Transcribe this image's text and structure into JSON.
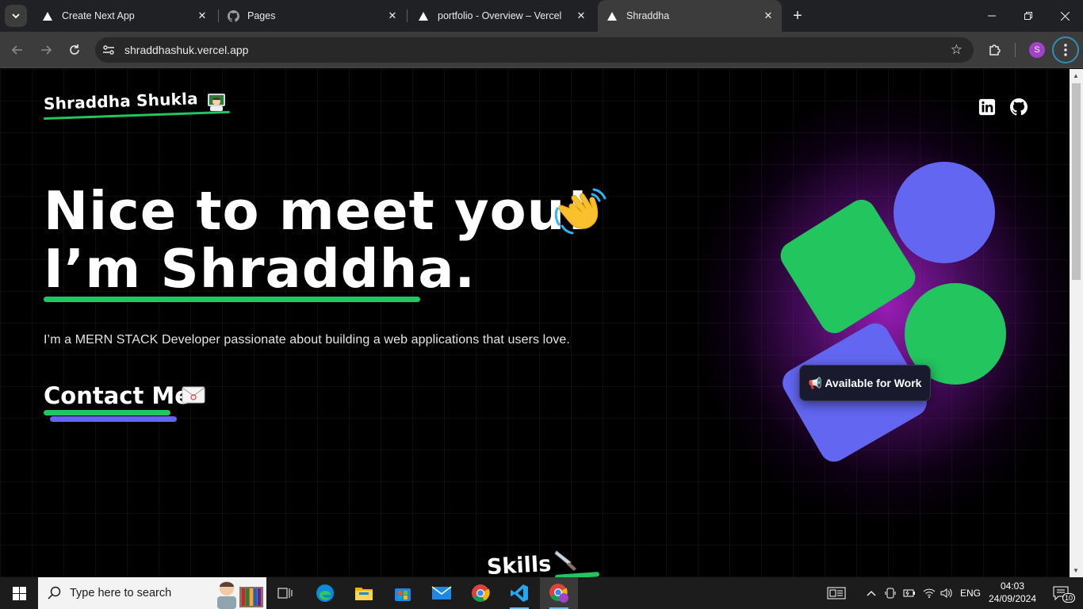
{
  "browser": {
    "tabs": [
      {
        "title": "Create Next App",
        "icon": "vercel-triangle-icon"
      },
      {
        "title": "Pages",
        "icon": "github-icon"
      },
      {
        "title": "portfolio - Overview – Vercel",
        "icon": "vercel-triangle-icon"
      },
      {
        "title": "Shraddha",
        "icon": "vercel-triangle-icon",
        "active": true
      }
    ],
    "url": "shraddhashuk.vercel.app",
    "profile_initial": "S"
  },
  "page": {
    "brand_name": "Shraddha Shukla",
    "hero_line1": "Nice to meet you!",
    "hero_line2": "I’m Shraddha.",
    "intro": "I’m a MERN STACK Developer passionate about building a web applications that users love.",
    "contact_label": "Contact Me",
    "badge_label": "📢 Available for Work",
    "skills_heading": "Skills",
    "colors": {
      "accent_green": "#22c55e",
      "accent_indigo": "#6366f1",
      "glow_purple": "#9b1fc0"
    }
  },
  "taskbar": {
    "search_placeholder": "Type here to search",
    "language": "ENG",
    "time": "04:03",
    "date": "24/09/2024",
    "notification_count": "10"
  }
}
